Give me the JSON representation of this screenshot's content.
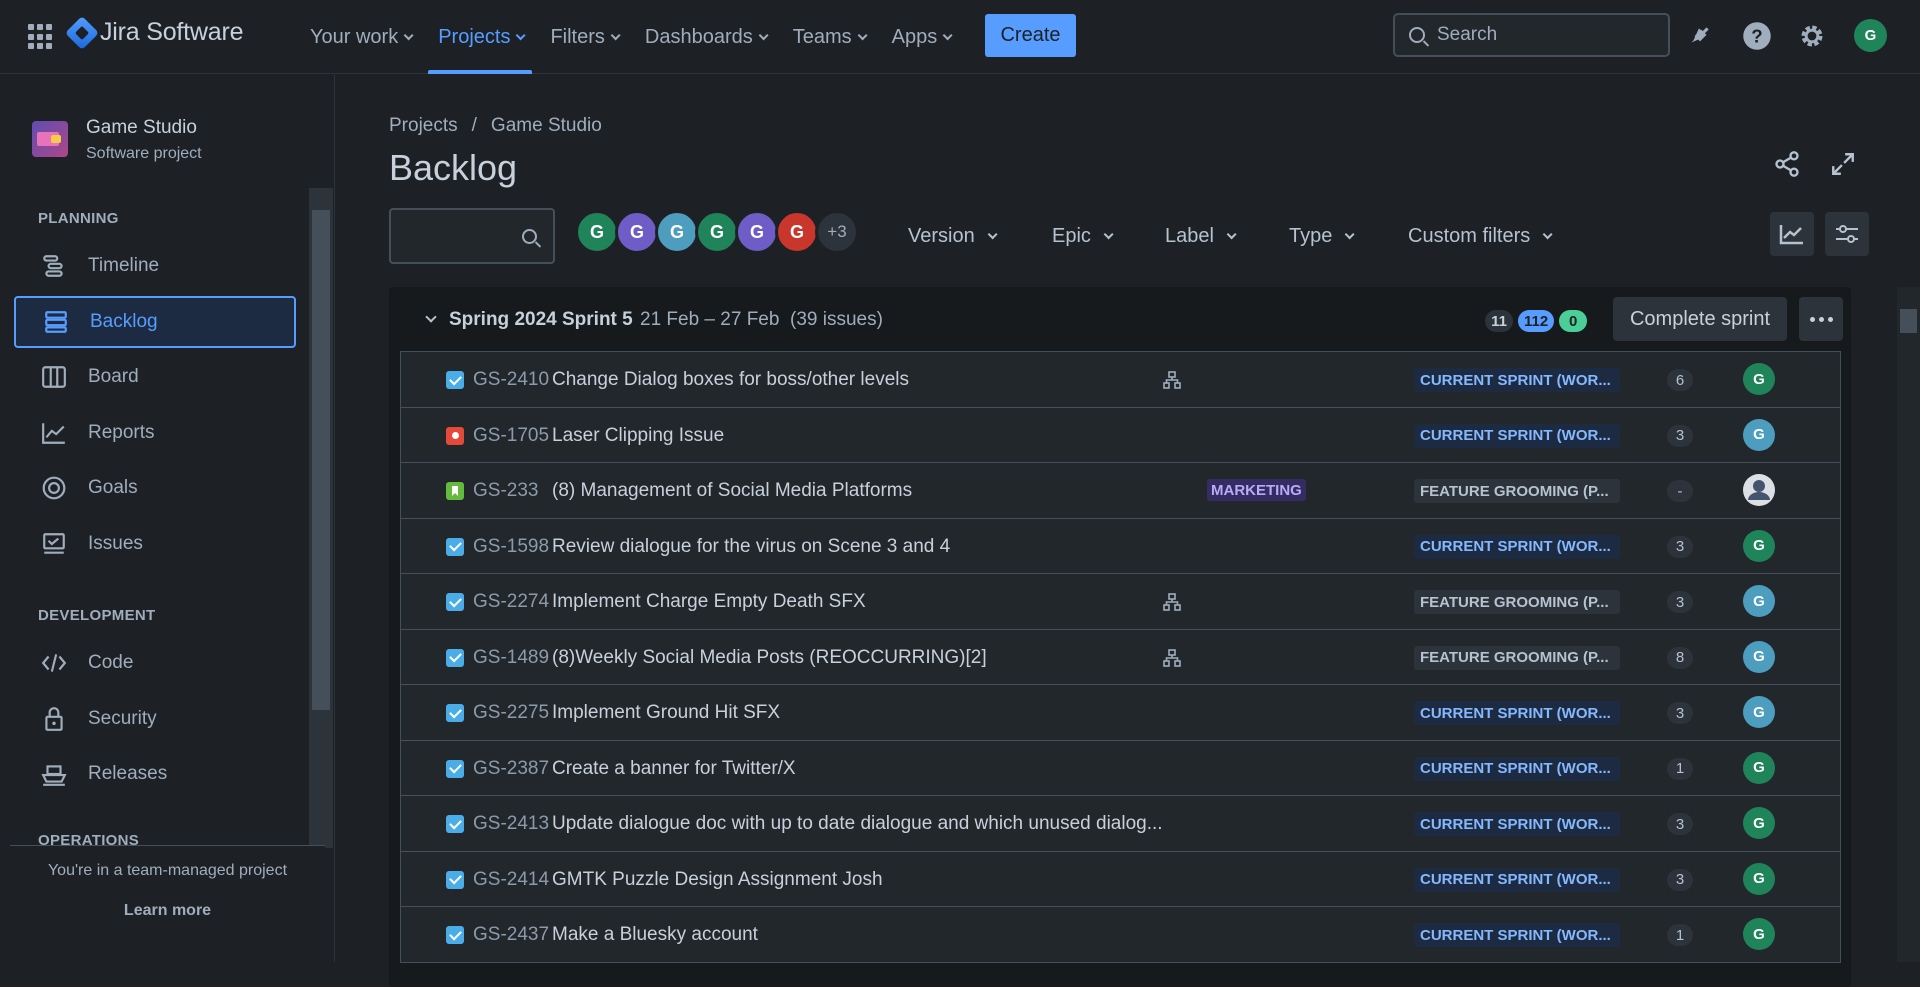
{
  "app": {
    "name": "Jira Software"
  },
  "nav": [
    {
      "label": "Your work",
      "active": false
    },
    {
      "label": "Projects",
      "active": true
    },
    {
      "label": "Filters",
      "active": false
    },
    {
      "label": "Dashboards",
      "active": false
    },
    {
      "label": "Teams",
      "active": false
    },
    {
      "label": "Apps",
      "active": false
    }
  ],
  "create_label": "Create",
  "search": {
    "placeholder": "Search"
  },
  "user_initial": "G",
  "project": {
    "name": "Game Studio",
    "type": "Software project"
  },
  "sidebar": {
    "planning_heading": "PLANNING",
    "planning": [
      {
        "label": "Timeline",
        "icon": "timeline-icon"
      },
      {
        "label": "Backlog",
        "icon": "backlog-icon",
        "active": true
      },
      {
        "label": "Board",
        "icon": "board-icon"
      },
      {
        "label": "Reports",
        "icon": "reports-icon"
      },
      {
        "label": "Goals",
        "icon": "goals-icon"
      },
      {
        "label": "Issues",
        "icon": "issues-icon"
      }
    ],
    "development_heading": "DEVELOPMENT",
    "development": [
      {
        "label": "Code",
        "icon": "code-icon"
      },
      {
        "label": "Security",
        "icon": "lock-icon"
      },
      {
        "label": "Releases",
        "icon": "ship-icon"
      }
    ],
    "operations_heading": "OPERATIONS",
    "footer_note": "You're in a team-managed project",
    "learn_more": "Learn more"
  },
  "breadcrumb": [
    "Projects",
    "Game Studio"
  ],
  "page_title": "Backlog",
  "filters": {
    "avatars": [
      {
        "initial": "G",
        "color": "#1f845a"
      },
      {
        "initial": "G",
        "color": "#6e5dc6"
      },
      {
        "initial": "G",
        "color": "#4d9dbf"
      },
      {
        "initial": "G",
        "color": "#1f845a"
      },
      {
        "initial": "G",
        "color": "#6e5dc6"
      },
      {
        "initial": "G",
        "color": "#c9372c"
      }
    ],
    "more_avatars": "+3",
    "selects": [
      "Version",
      "Epic",
      "Label",
      "Type",
      "Custom filters"
    ]
  },
  "sprint": {
    "name": "Spring 2024 Sprint 5",
    "dates": "21 Feb – 27 Feb",
    "issue_count": "(39 issues)",
    "counts": {
      "todo": "11",
      "in_progress": "112",
      "done": "0"
    },
    "complete_label": "Complete sprint"
  },
  "issues": [
    {
      "type": "task",
      "key": "GS-2410",
      "summary": "Change Dialog boxes for boss/other levels",
      "child": true,
      "label": "",
      "status": "CURRENT SPRINT (WOR...",
      "status_color": "blue",
      "points": "6",
      "assignee": "G",
      "assignee_color": "g"
    },
    {
      "type": "bug",
      "key": "GS-1705",
      "summary": "Laser Clipping Issue",
      "child": false,
      "label": "",
      "status": "CURRENT SPRINT (WOR...",
      "status_color": "blue",
      "points": "3",
      "assignee": "G",
      "assignee_color": "b"
    },
    {
      "type": "story",
      "key": "GS-233",
      "summary": "(8) Management of Social Media Platforms",
      "child": false,
      "label": "MARKETING",
      "status": "FEATURE GROOMING (P...",
      "status_color": "grey",
      "points": "-",
      "assignee": "",
      "assignee_color": "gr"
    },
    {
      "type": "task",
      "key": "GS-1598",
      "summary": "Review dialogue for the virus on Scene 3 and 4",
      "child": false,
      "label": "",
      "status": "CURRENT SPRINT (WOR...",
      "status_color": "blue",
      "points": "3",
      "assignee": "G",
      "assignee_color": "g"
    },
    {
      "type": "task",
      "key": "GS-2274",
      "summary": "Implement Charge Empty Death SFX",
      "child": true,
      "label": "",
      "status": "FEATURE GROOMING (P...",
      "status_color": "grey",
      "points": "3",
      "assignee": "G",
      "assignee_color": "b"
    },
    {
      "type": "task",
      "key": "GS-1489",
      "summary": "(8)Weekly Social Media Posts (REOCCURRING)[2]",
      "child": true,
      "label": "",
      "status": "FEATURE GROOMING (P...",
      "status_color": "grey",
      "points": "8",
      "assignee": "G",
      "assignee_color": "b"
    },
    {
      "type": "task",
      "key": "GS-2275",
      "summary": "Implement Ground Hit SFX",
      "child": false,
      "label": "",
      "status": "CURRENT SPRINT (WOR...",
      "status_color": "blue",
      "points": "3",
      "assignee": "G",
      "assignee_color": "b"
    },
    {
      "type": "task",
      "key": "GS-2387",
      "summary": "Create a banner for Twitter/X",
      "child": false,
      "label": "",
      "status": "CURRENT SPRINT (WOR...",
      "status_color": "blue",
      "points": "1",
      "assignee": "G",
      "assignee_color": "g"
    },
    {
      "type": "task",
      "key": "GS-2413",
      "summary": "Update dialogue doc with up to date dialogue and which unused dialog...",
      "child": false,
      "label": "",
      "status": "CURRENT SPRINT (WOR...",
      "status_color": "blue",
      "points": "3",
      "assignee": "G",
      "assignee_color": "g"
    },
    {
      "type": "task",
      "key": "GS-2414",
      "summary": "GMTK Puzzle Design Assignment Josh",
      "child": false,
      "label": "",
      "status": "CURRENT SPRINT (WOR...",
      "status_color": "blue",
      "points": "3",
      "assignee": "G",
      "assignee_color": "g"
    },
    {
      "type": "task",
      "key": "GS-2437",
      "summary": "Make a Bluesky account",
      "child": false,
      "label": "",
      "status": "CURRENT SPRINT (WOR...",
      "status_color": "blue",
      "points": "1",
      "assignee": "G",
      "assignee_color": "g"
    }
  ]
}
